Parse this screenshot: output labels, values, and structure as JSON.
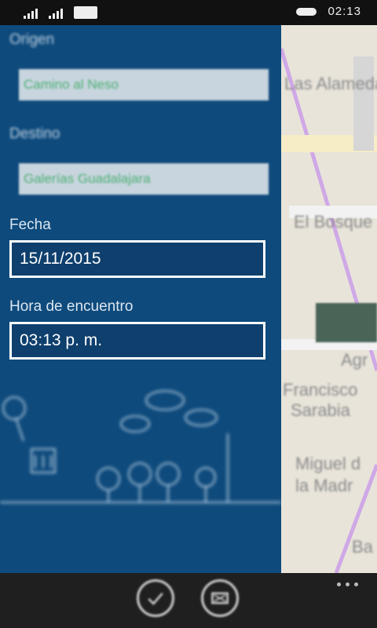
{
  "status_bar": {
    "time": "02:13",
    "icons": [
      "signal-icon",
      "wifi-signal-icon",
      "battery-icon",
      "cloud-icon"
    ]
  },
  "form": {
    "origin_label": "Origen",
    "origin_value": "Camino al Neso",
    "destination_label": "Destino",
    "destination_value": "Galerías Guadalajara",
    "date_label": "Fecha",
    "date_value": "15/11/2015",
    "time_label": "Hora de encuentro",
    "time_value": "03:13 p. m."
  },
  "map": {
    "labels": [
      "Las Alameda",
      "El Bosque",
      "Agr",
      "Francisco",
      "Sarabia",
      "Miguel d",
      "la Madr",
      "Ba"
    ]
  },
  "app_bar": {
    "buttons": [
      "check-icon",
      "cancel-icon"
    ]
  },
  "colors": {
    "panel": "#0e4a7c",
    "app_bar": "#1f1f1f",
    "accent_text": "#4caf74"
  }
}
